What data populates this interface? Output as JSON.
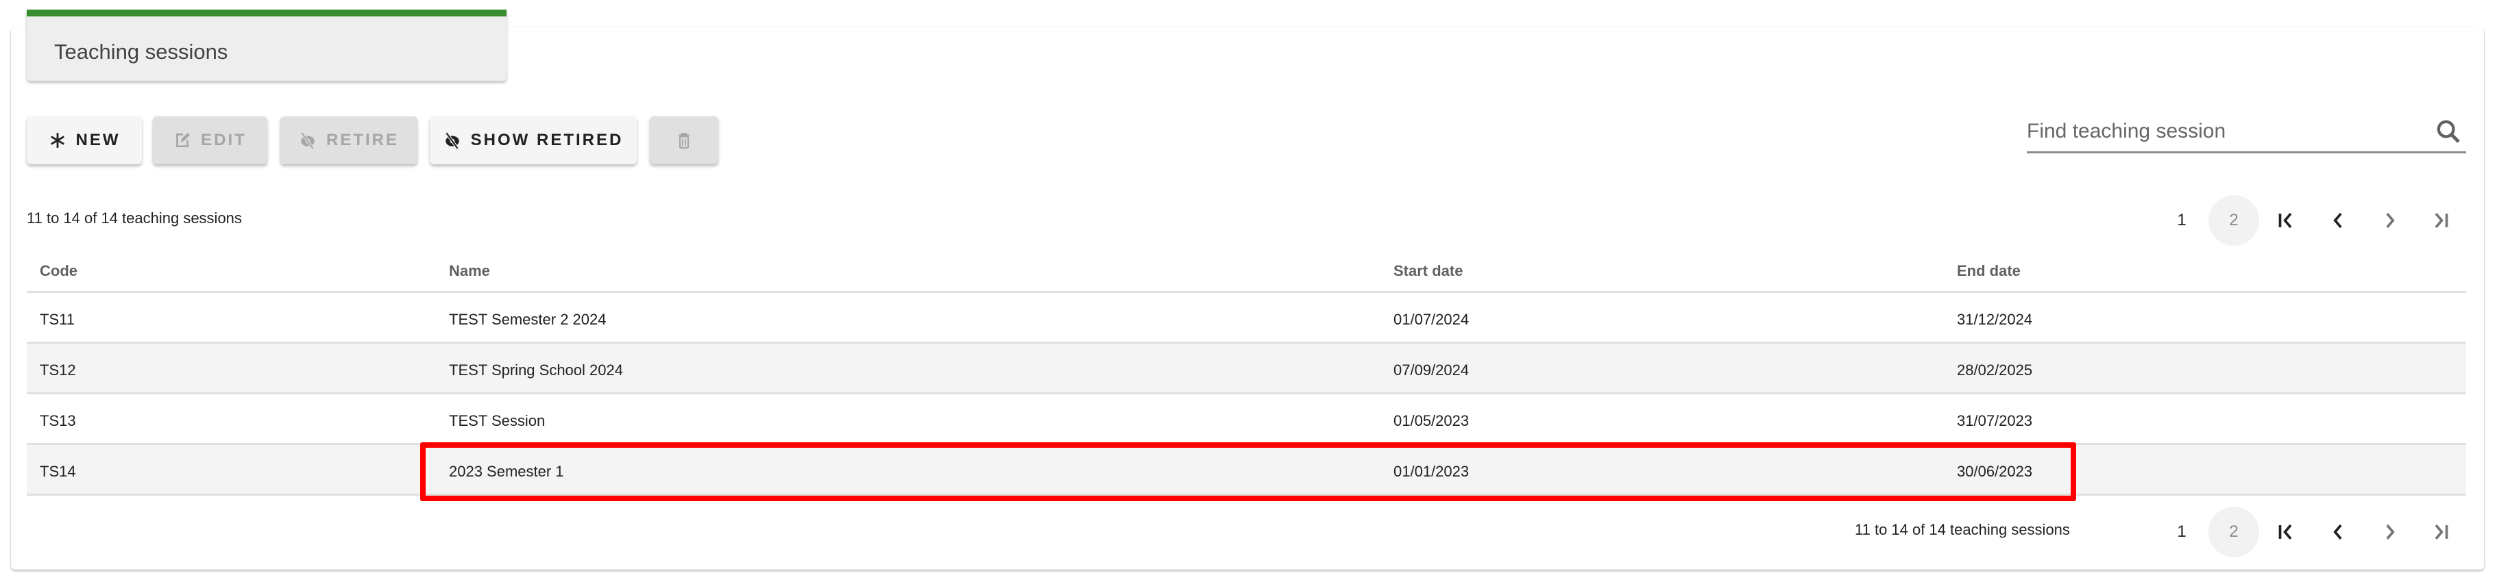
{
  "header": {
    "title": "Teaching sessions",
    "accent_color": "#388e2f"
  },
  "toolbar": {
    "new_label": "NEW",
    "edit_label": "EDIT",
    "retire_label": "RETIRE",
    "show_retired_label": "SHOW RETIRED",
    "delete_label": ""
  },
  "search": {
    "placeholder": "Find teaching session",
    "value": ""
  },
  "pagination": {
    "summary": "11 to 14 of 14 teaching sessions",
    "pages": [
      "1",
      "2"
    ],
    "current_page": "2"
  },
  "table": {
    "columns": [
      "Code",
      "Name",
      "Start date",
      "End date"
    ],
    "rows": [
      {
        "code": "TS11",
        "name": "TEST Semester 2 2024",
        "start": "01/07/2024",
        "end": "31/12/2024"
      },
      {
        "code": "TS12",
        "name": "TEST Spring School 2024",
        "start": "07/09/2024",
        "end": "28/02/2025"
      },
      {
        "code": "TS13",
        "name": "TEST Session",
        "start": "01/05/2023",
        "end": "31/07/2023"
      },
      {
        "code": "TS14",
        "name": "2023 Semester 1",
        "start": "01/01/2023",
        "end": "30/06/2023"
      }
    ],
    "highlighted_row": "TS14",
    "highlight_color": "#ff0000"
  }
}
